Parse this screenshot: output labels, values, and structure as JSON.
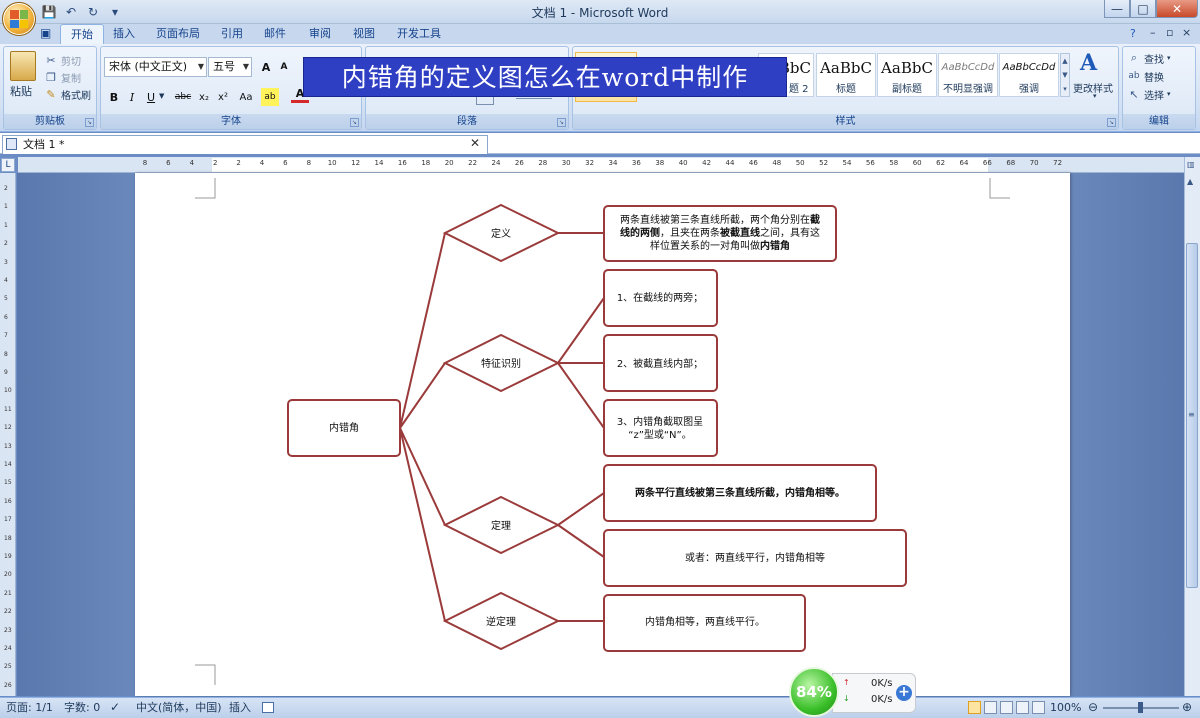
{
  "window": {
    "title": "文档 1 - Microsoft Word",
    "min_label": "—",
    "max_label": "□",
    "close_label": "✕"
  },
  "qat": {
    "save_icon": "💾",
    "undo_icon": "↶",
    "redo_icon": "↻",
    "more_icon": "▾"
  },
  "tabs": [
    {
      "label": "开始",
      "active": true
    },
    {
      "label": "插入"
    },
    {
      "label": "页面布局"
    },
    {
      "label": "引用"
    },
    {
      "label": "邮件"
    },
    {
      "label": "审阅"
    },
    {
      "label": "视图"
    },
    {
      "label": "开发工具"
    }
  ],
  "ribbon_right_icons": {
    "help": "?",
    "min": "–",
    "restore": "▫",
    "close": "×"
  },
  "clipboard": {
    "paste": "粘贴",
    "cut": "剪切",
    "copy": "复制",
    "format_painter": "格式刷",
    "label": "剪贴板"
  },
  "font": {
    "family": "宋体 (中文正文)",
    "size": "五号",
    "label": "字体",
    "grow": "A",
    "shrink": "A",
    "bold": "B",
    "italic": "I",
    "underline": "U",
    "strike": "abc",
    "sub": "x₂",
    "sup": "x²",
    "case": "Aa",
    "highlight": "ab",
    "color": "A"
  },
  "paragraph": {
    "label": "段落"
  },
  "styles": {
    "label": "样式",
    "items": [
      {
        "sample": "BbC",
        "name": "题 2"
      },
      {
        "sample": "AaBbC",
        "name": "标题"
      },
      {
        "sample": "AaBbC",
        "name": "副标题"
      },
      {
        "sample": "AaBbCcDd",
        "name": "不明显强调"
      },
      {
        "sample": "AaBbCcDd",
        "name": "强调"
      }
    ],
    "change_styles": "更改样式"
  },
  "editing": {
    "label": "编辑",
    "find": "查找",
    "replace": "替换",
    "select": "选择"
  },
  "banner": "内错角的定义图怎么在word中制作",
  "doc_tab": {
    "label": "文档 1 *",
    "close": "✕"
  },
  "ruler": {
    "h_ticks": [
      "8",
      "6",
      "4",
      "2",
      "2",
      "4",
      "6",
      "8",
      "10",
      "12",
      "14",
      "16",
      "18",
      "20",
      "22",
      "24",
      "26",
      "28",
      "30",
      "32",
      "34",
      "36",
      "38",
      "40",
      "42",
      "44",
      "46",
      "48",
      "50",
      "52",
      "54",
      "56",
      "58",
      "60",
      "62",
      "64",
      "66",
      "68",
      "70",
      "72"
    ],
    "v_ticks": [
      "2",
      "1",
      "1",
      "2",
      "3",
      "4",
      "5",
      "6",
      "7",
      "8",
      "9",
      "10",
      "11",
      "12",
      "13",
      "14",
      "15",
      "16",
      "17",
      "18",
      "19",
      "20",
      "21",
      "22",
      "23",
      "24",
      "25",
      "26",
      "27"
    ],
    "corner": "L"
  },
  "mindmap": {
    "root": "内错角",
    "branches": [
      {
        "label": "定义"
      },
      {
        "label": "特征识别"
      },
      {
        "label": "定理"
      },
      {
        "label": "逆定理"
      }
    ],
    "definition_box": {
      "line1a": "两条直线被第三条直线所截，两个角分别在",
      "line1b": "截",
      "line2a": "线的两侧",
      "line2b": "，且夹在两条",
      "line2c": "被截直线",
      "line2d": "之间，具有这",
      "line3a": "样位置关系的一对角叫做",
      "line3b": "内错角"
    },
    "features": [
      "1、在截线的两旁；",
      "2、被截直线内部；",
      "3、内错角截取图呈",
      "“z”型或“N”。"
    ],
    "theorem": [
      "两条平行直线被第三条直线所截，内错角相等。",
      "或者：两直线平行，内错角相等"
    ],
    "converse": "内错角相等，两直线平行。",
    "line_color": "#9a3a3a"
  },
  "status": {
    "page": "页面: 1/1",
    "words": "字数: 0",
    "lang": "中文(简体，中国)",
    "mode": "插入",
    "zoom": "100%"
  },
  "net": {
    "percent": "84%",
    "up": "0K/s",
    "down": "0K/s",
    "plus": "+"
  }
}
